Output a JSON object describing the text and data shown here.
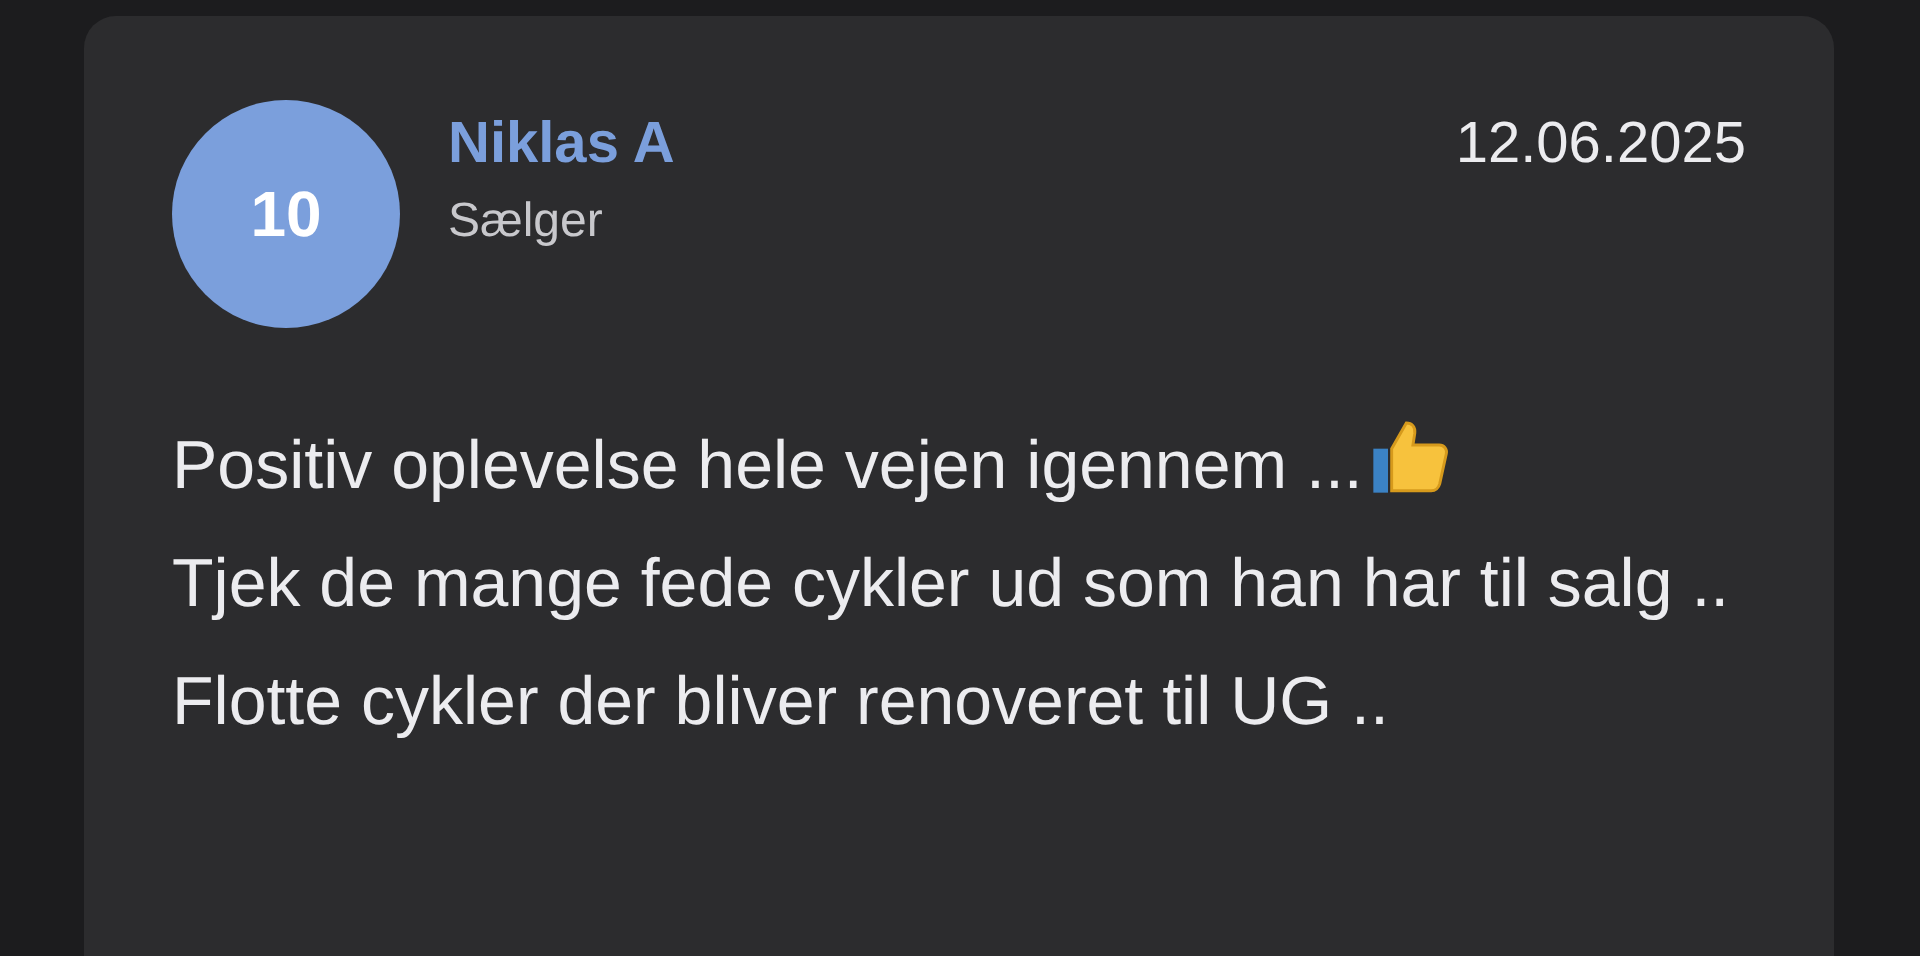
{
  "review": {
    "avatar": "10",
    "name": "Niklas A",
    "role": "Sælger",
    "date": "12.06.2025",
    "lines": [
      {
        "text": "Positiv oplevelse hele vejen igennem ...",
        "thumbs_up": true
      },
      {
        "text": "Tjek de mange fede cykler ud som han har til salg ..",
        "thumbs_up": false
      },
      {
        "text": "Flotte cykler der bliver renoveret til UG ..",
        "thumbs_up": false
      }
    ]
  }
}
